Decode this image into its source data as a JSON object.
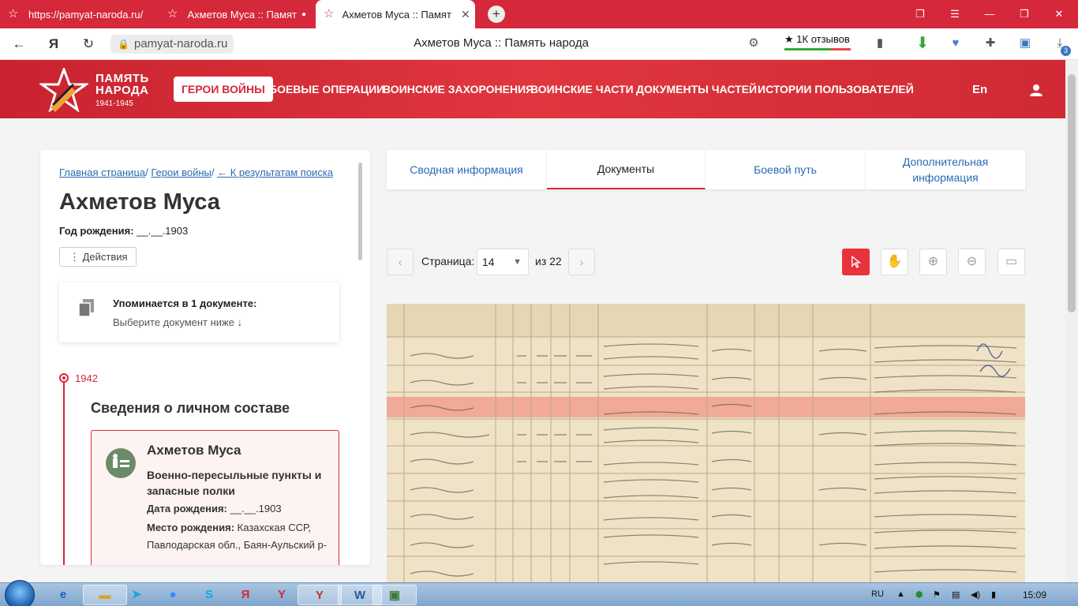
{
  "browser": {
    "tabs": [
      {
        "label": "https://pamyat-naroda.ru/",
        "active": false
      },
      {
        "label": "Ахметов Муса :: Памят",
        "active": false
      },
      {
        "label": "Ахметов Муса :: Памят",
        "active": true
      }
    ],
    "url": "pamyat-naroda.ru",
    "page_title": "Ахметов Муса :: Память народа",
    "reviews": "1К отзывов",
    "notification_count": "3"
  },
  "site": {
    "logo_line1": "ПАМЯТЬ",
    "logo_line2": "НАРОДА",
    "logo_years": "1941-1945",
    "menu": [
      "ГЕРОИ ВОЙНЫ",
      "БОЕВЫЕ ОПЕРАЦИИ",
      "ВОИНСКИЕ ЗАХОРОНЕНИЯ",
      "ВОИНСКИЕ ЧАСТИ",
      "ДОКУМЕНТЫ ЧАСТЕЙ",
      "ИСТОРИИ ПОЛЬЗОВАТЕЛЕЙ"
    ],
    "lang": "En"
  },
  "profile": {
    "breadcrumbs": [
      "Главная страница",
      "Герои войны",
      "← К результатам поиска"
    ],
    "name": "Ахметов Муса",
    "birth_label": "Год рождения:",
    "birth_value": "__.__.1903",
    "actions_label": "Действия",
    "mentions_title": "Упоминается в 1 документе:",
    "mentions_hint": "Выберите документ ниже ↓",
    "timeline_year": "1942",
    "section_title": "Сведения о личном составе",
    "record": {
      "name": "Ахметов Муса",
      "type": "Военно-пересыльные пункты и запасные полки",
      "birth_date_label": "Дата рождения:",
      "birth_date_value": "__.__.1903",
      "birth_place_label": "Место рождения:",
      "birth_place_value": "Казахская ССР, Павлодарская обл., Баян-Аульский р-"
    }
  },
  "doc_tabs": [
    {
      "label": "Сводная информация",
      "active": false
    },
    {
      "label": "Документы",
      "active": true
    },
    {
      "label": "Боевой путь",
      "active": false
    },
    {
      "label": "Дополнительная информация",
      "active": false
    }
  ],
  "pager": {
    "page_label": "Страница:",
    "current_page": "14",
    "of_label": "из 22"
  },
  "viewer_tools": [
    "pointer-icon",
    "hand-icon",
    "zoom-in-icon",
    "zoom-out-icon",
    "fullscreen-icon"
  ],
  "taskbar": {
    "lang": "RU",
    "time": "15:09"
  },
  "colors": {
    "brand_red": "#d5283b",
    "link_blue": "#2a6ab4",
    "highlight_row": "#f0a08e"
  }
}
